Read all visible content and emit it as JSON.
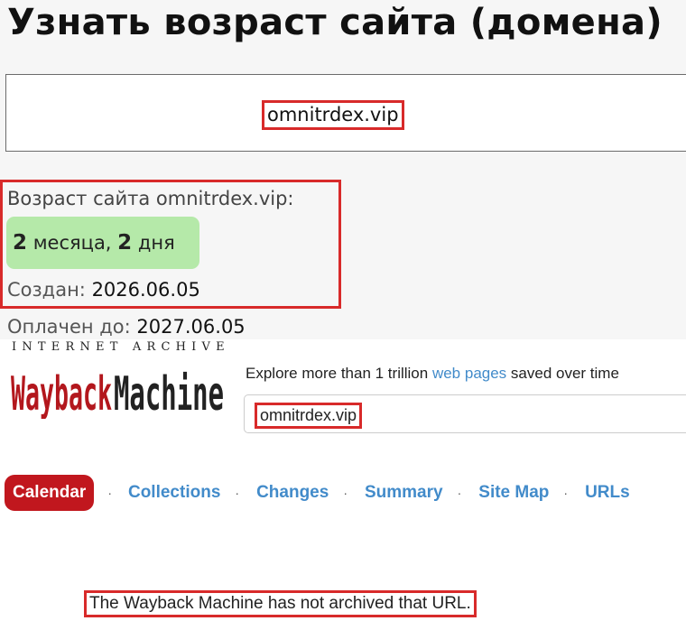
{
  "checker": {
    "title": "Узнать возраст сайта (домена)",
    "domain": "omnitrdex.vip",
    "age_label": "Возраст сайта omnitrdex.vip:",
    "age": {
      "months": "2",
      "months_word": "месяца,",
      "days": "2",
      "days_word": "дня"
    },
    "created_label": "Создан:",
    "created_value": "2026.06.05",
    "paid_label": "Оплачен до:",
    "paid_value": "2027.06.05",
    "colors": {
      "highlight_border": "#d82a2a",
      "age_badge": "#b5e9a9"
    }
  },
  "wayback": {
    "brand_top": "INTERNET ARCHIVE",
    "logo_text_red": "Wayback",
    "logo_text_black": "Machine",
    "explore_prefix": "Explore more than 1 trillion",
    "explore_link": "web pages",
    "explore_suffix": "saved over time",
    "search_value": "omnitrdex.vip",
    "tabs": [
      {
        "label": "Calendar",
        "active": true
      },
      {
        "label": "Collections",
        "active": false
      },
      {
        "label": "Changes",
        "active": false
      },
      {
        "label": "Summary",
        "active": false
      },
      {
        "label": "Site Map",
        "active": false
      },
      {
        "label": "URLs",
        "active": false
      }
    ],
    "separator": "·",
    "message": "The Wayback Machine has not archived that URL.",
    "colors": {
      "brand_red": "#b3171d",
      "link": "#428bca",
      "active_tab": "#c1171e"
    }
  }
}
